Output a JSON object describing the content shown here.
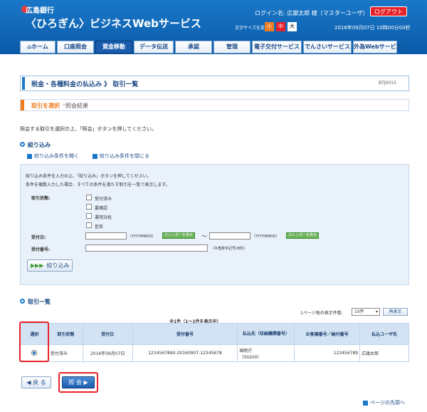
{
  "header": {
    "bank_name": "広島銀行",
    "service_name": "〈ひろぎん〉ビジネスWebサービス",
    "login_text": "ログイン名: 広銀太郎 様（マスターユーザ）",
    "logout_label": "ログアウト",
    "font_size_label": "文字サイズを変更",
    "font_sizes": [
      "小",
      "中",
      "大"
    ],
    "datetime": "2016年09月07日 10時00分00秒"
  },
  "nav": {
    "tabs": [
      {
        "label": "ホーム"
      },
      {
        "label": "口座照会"
      },
      {
        "label": "資金移動"
      },
      {
        "label": "データ伝送"
      },
      {
        "label": "承認"
      },
      {
        "label": "管理"
      },
      {
        "label": "電子交付サービス"
      },
      {
        "label": "でんさいサービス"
      },
      {
        "label": "外為Webサービス"
      }
    ]
  },
  "page": {
    "title": "税金・各種料金の払込み 》 取引一覧",
    "screen_id": "BTJS015",
    "steps": [
      "取引を選択",
      "照会結果"
    ],
    "instruction": "照会する取引を選択の上、「照会」ボタンを押してください。"
  },
  "filter": {
    "section_title": "絞り込み",
    "open_link": "絞り込み条件を開く",
    "close_link": "絞り込み条件を閉じる",
    "help_line1": "絞り込み条件を入力の上、「絞り込み」ボタンを押してください。",
    "help_line2": "条件を複数入力した場合、すべての条件を満たす取引を一覧で表示します。",
    "status_label": "取引状態:",
    "status_options": [
      "受付済み",
      "要確認",
      "運用対処",
      "拒否"
    ],
    "date_label": "受付日:",
    "date_format": "（YYYYMMDD）",
    "calendar_label": "カレンダーを表示",
    "tilde": "～",
    "number_label": "受付番号:",
    "number_hint": "（半角数字記号28桁）",
    "button_label": "絞り込み"
  },
  "list": {
    "section_title": "取引一覧",
    "per_page_label": "1ページ毎の表示件数:",
    "per_page_value": "10件",
    "show_label": "再表示",
    "count_text": "全1件（1～1件を表示中）",
    "headers": [
      "選択",
      "取引状態",
      "受付日",
      "受付番号",
      "払込先（収納機関番号）",
      "お客様番号／納付番号",
      "払込ユーザ名"
    ],
    "rows": [
      {
        "status": "受付済み",
        "date": "2016年09月07日",
        "number": "1234567890-20160907-12345678",
        "payee": "国税庁",
        "payee_code": "（00200）",
        "customer_no": "123456789",
        "user": "広銀太郎"
      }
    ]
  },
  "footer": {
    "back_label": "◀ 戻 る",
    "inquiry_label": "照 会 ▶",
    "page_top": "ページの先頭へ"
  }
}
